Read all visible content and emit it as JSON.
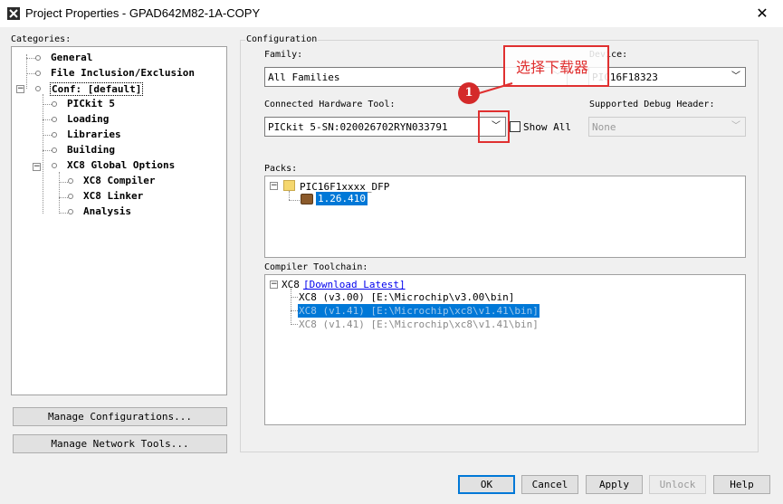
{
  "window": {
    "title": "Project Properties - GPAD642M82-1A-COPY",
    "close_glyph": "✕"
  },
  "categories": {
    "label": "Categories:",
    "items": [
      {
        "label": "General"
      },
      {
        "label": "File Inclusion/Exclusion"
      },
      {
        "label": "Conf: [default]"
      },
      {
        "label": "PICkit 5"
      },
      {
        "label": "Loading"
      },
      {
        "label": "Libraries"
      },
      {
        "label": "Building"
      },
      {
        "label": "XC8 Global Options"
      },
      {
        "label": "XC8 Compiler"
      },
      {
        "label": "XC8 Linker"
      },
      {
        "label": "Analysis"
      }
    ],
    "manage_configurations": "Manage Configurations...",
    "manage_network_tools": "Manage Network Tools..."
  },
  "configuration": {
    "label": "Configuration",
    "family_label": "Family:",
    "family_value": "All Families",
    "device_label": "Device:",
    "device_value": "PIC16F18323",
    "hardware_tool_label": "Connected Hardware Tool:",
    "hardware_tool_value": "PICkit 5-SN:020026702RYN033791",
    "show_all_label": "Show All",
    "debug_header_label": "Supported Debug Header:",
    "debug_header_value": "None",
    "packs_label": "Packs:",
    "pack_name": "PIC16F1xxxx_DFP",
    "pack_version": "1.26.410",
    "toolchain_label": "Compiler Toolchain:",
    "toolchain_root": "XC8",
    "download_latest": "[Download Latest]",
    "toolchains": [
      {
        "text": "XC8 (v3.00) [E:\\Microchip\\v3.00\\bin]"
      },
      {
        "text": "XC8 (v1.41) [E:\\Microchip\\xc8\\v1.41\\bin]"
      },
      {
        "text": "XC8 (v1.41) [E:\\Microchip\\xc8\\v1.41\\bin]"
      }
    ]
  },
  "annotation": {
    "callout_text": "选择下载器",
    "step_number": "1",
    "color": "#e03030"
  },
  "buttons": {
    "ok": "OK",
    "cancel": "Cancel",
    "apply": "Apply",
    "unlock": "Unlock",
    "help": "Help"
  },
  "colors": {
    "selection": "#0078d7",
    "link": "#0000ee"
  }
}
